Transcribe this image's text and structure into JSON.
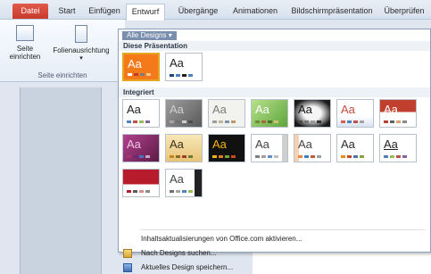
{
  "tabs": [
    "Datei",
    "Start",
    "Einfügen",
    "Entwurf",
    "Übergänge",
    "Animationen",
    "Bildschirmpräsentation",
    "Überprüfen"
  ],
  "ribbon": {
    "btn_page_setup": "Seite einrichten",
    "btn_orientation": "Folienausrichtung",
    "group_label": "Seite einrichten"
  },
  "gallery": {
    "dropdown_label": "Alle Designs ▾",
    "section_this": "Diese Präsentation",
    "section_builtin": "Integriert",
    "thumb_text": "Aa",
    "cmd_update": "Inhaltsaktualisierungen von Office.com aktivieren...",
    "cmd_browse": "Nach Designs suchen...",
    "cmd_save": "Aktuelles Design speichern..."
  },
  "colors": {
    "accent_selected": "#e8a425",
    "file_tab": "#d24a3a",
    "theme_orange": "#f47a19"
  }
}
